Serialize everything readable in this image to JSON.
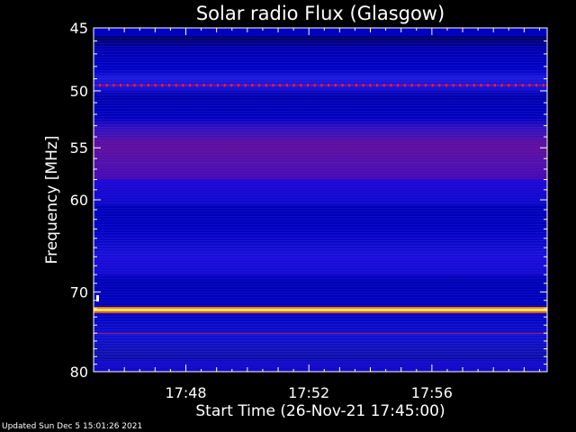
{
  "chart_data": {
    "type": "heatmap",
    "title": "Solar radio Flux (Glasgow)",
    "xlabel": "Start Time (26-Nov-21 17:45:00)",
    "ylabel": "Frequency [MHz]",
    "x_range": [
      "17:45:00",
      "17:59:45"
    ],
    "y_range": [
      45,
      80
    ],
    "y_scale": "log",
    "y_ticks": [
      45,
      50,
      55,
      60,
      70,
      80
    ],
    "x_ticks": [
      "17:48",
      "17:52",
      "17:56"
    ],
    "colors": {
      "background": "#000000",
      "low": "#0000c0",
      "medium": "#2010e0",
      "elevated": "#6010a0",
      "high": "#ff2020",
      "peak": "#ffff60"
    },
    "bands": [
      {
        "from_mhz": 45.0,
        "to_mhz": 45.6,
        "level": "low"
      },
      {
        "from_mhz": 49.0,
        "to_mhz": 50.0,
        "level": "medium"
      },
      {
        "from_mhz": 49.5,
        "to_mhz": 49.5,
        "level": "high"
      },
      {
        "from_mhz": 54.2,
        "to_mhz": 58.0,
        "level": "elevated"
      },
      {
        "from_mhz": 58.0,
        "to_mhz": 60.5,
        "level": "medium"
      },
      {
        "from_mhz": 66.0,
        "to_mhz": 68.0,
        "level": "medium"
      },
      {
        "from_mhz": 72.0,
        "to_mhz": 72.3,
        "level": "peak"
      },
      {
        "from_mhz": 75.0,
        "to_mhz": 75.0,
        "level": "high"
      },
      {
        "from_mhz": 78.5,
        "to_mhz": 80.0,
        "level": "medium"
      }
    ]
  },
  "footer_text": "Updated Sun Dec  5 15:01:26 2021"
}
